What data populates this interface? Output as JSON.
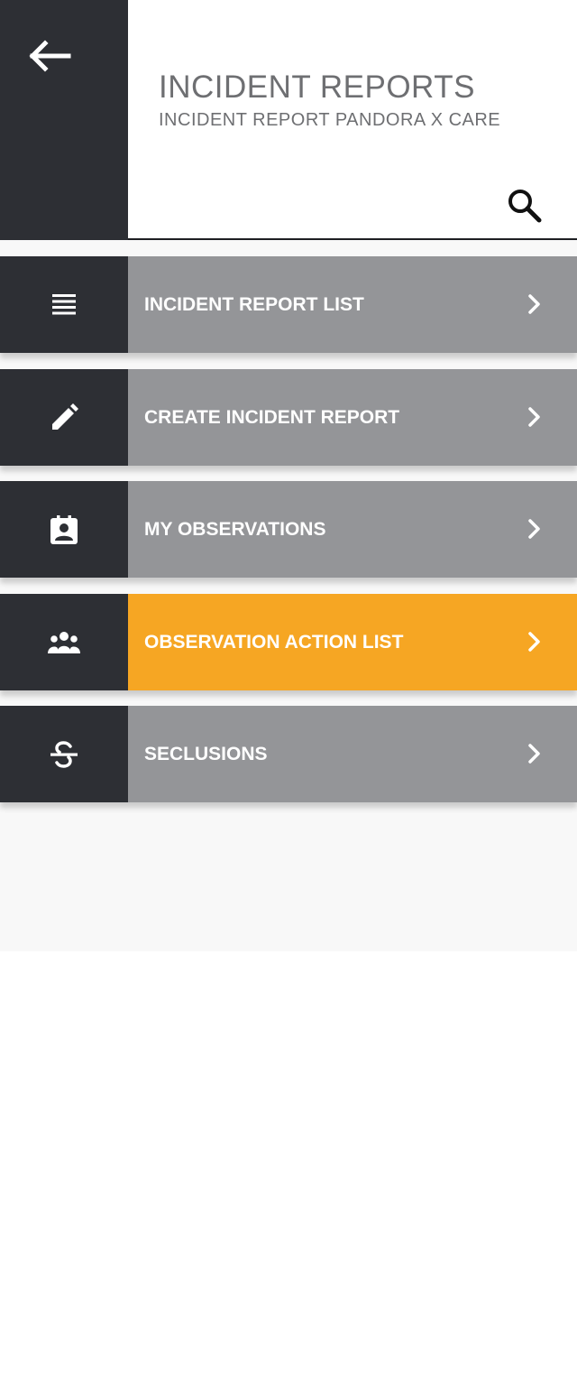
{
  "header": {
    "title": "INCIDENT REPORTS",
    "subtitle": "INCIDENT REPORT PANDORA X CARE",
    "back_icon": "arrow-left-icon",
    "search_icon": "search-icon"
  },
  "menu": {
    "items": [
      {
        "label": "INCIDENT REPORT LIST",
        "icon": "list-icon",
        "active": false
      },
      {
        "label": "CREATE INCIDENT REPORT",
        "icon": "pencil-icon",
        "active": false
      },
      {
        "label": "MY OBSERVATIONS",
        "icon": "contact-calendar-icon",
        "active": false
      },
      {
        "label": "OBSERVATION ACTION LIST",
        "icon": "people-group-icon",
        "active": true
      },
      {
        "label": "SECLUSIONS",
        "icon": "strikethrough-icon",
        "active": false
      }
    ]
  },
  "colors": {
    "dark_panel": "#2d2f34",
    "menu_default": "#949598",
    "menu_active": "#f6a623",
    "title_text": "#6e6f72"
  }
}
